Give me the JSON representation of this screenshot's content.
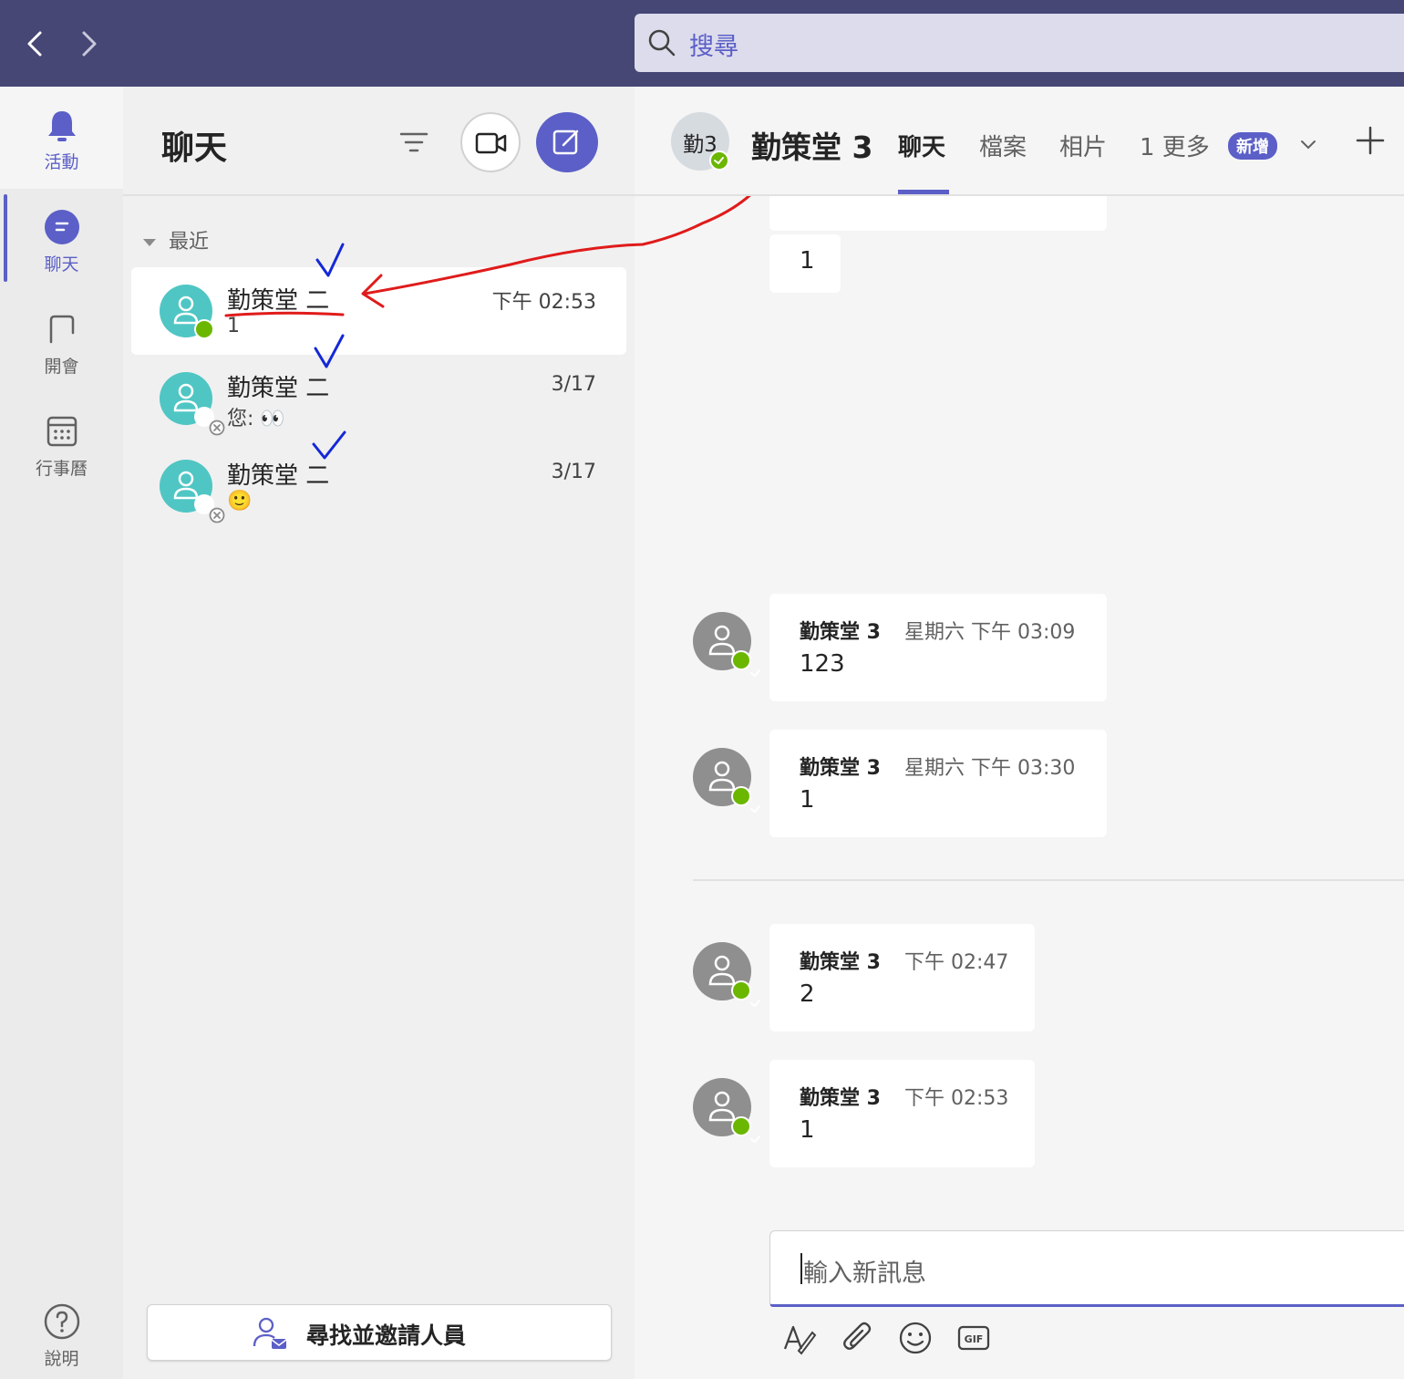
{
  "search": {
    "placeholder": "搜尋"
  },
  "rail": {
    "items": [
      {
        "label": "活動",
        "icon": "bell-icon"
      },
      {
        "label": "聊天",
        "icon": "chat-icon"
      },
      {
        "label": "開會",
        "icon": "meeting-icon"
      },
      {
        "label": "行事曆",
        "icon": "calendar-icon"
      }
    ],
    "help_label": "說明"
  },
  "chat_list": {
    "title": "聊天",
    "section_label": "最近",
    "items": [
      {
        "name": "勤策堂 二",
        "preview": "1",
        "time": "下午 02:53",
        "presence": "available"
      },
      {
        "name": "勤策堂 二",
        "preview": "您: 👀",
        "time": "3/17",
        "presence": "offline"
      },
      {
        "name": "勤策堂 二",
        "preview": "🙂",
        "time": "3/17",
        "presence": "offline"
      }
    ],
    "invite_label": "尋找並邀請人員"
  },
  "conversation": {
    "avatar_initials": "勤3",
    "title": "勤策堂 3",
    "tabs": [
      "聊天",
      "檔案",
      "相片",
      "1 更多"
    ],
    "new_badge": "新增",
    "messages_top": [
      "1"
    ],
    "messages": [
      {
        "sender": "勤策堂 3",
        "time": "星期六 下午 03:09",
        "text": "123"
      },
      {
        "sender": "勤策堂 3",
        "time": "星期六 下午 03:30",
        "text": "1"
      },
      {
        "sender": "勤策堂 3",
        "time": "下午 02:47",
        "text": "2"
      },
      {
        "sender": "勤策堂 3",
        "time": "下午 02:53",
        "text": "1"
      }
    ],
    "compose_placeholder": "輸入新訊息",
    "compose_tools": [
      "format-icon",
      "attach-icon",
      "emoji-icon",
      "gif-icon"
    ]
  },
  "colors": {
    "topbar": "#464775",
    "accent": "#5b5fc7",
    "avatar_teal": "#4fc6c4",
    "presence_available": "#6bb700",
    "annotation_red": "#e01b1b",
    "annotation_blue": "#1428d6"
  }
}
